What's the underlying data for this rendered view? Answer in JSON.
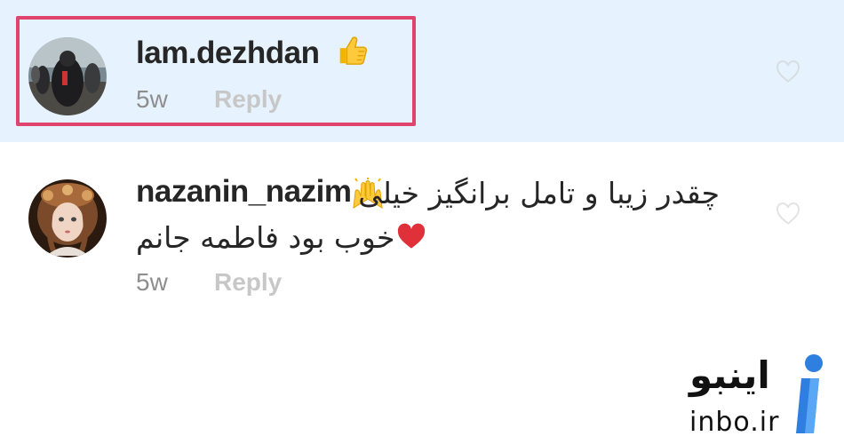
{
  "comments": [
    {
      "username": "lam.dezhdan",
      "emoji": "thumbs-up",
      "time": "5w",
      "reply_label": "Reply",
      "highlighted": true
    },
    {
      "username": "nazanin_nazim",
      "emoji": "raised-hands",
      "text_line1": "چقدر زیبا و تامل برانگیز خیلی",
      "text_line2": "خوب بود فاطمه جانم",
      "text_emoji": "red-heart",
      "time": "5w",
      "reply_label": "Reply",
      "highlighted": false
    }
  ],
  "watermark": {
    "name": "اینبو",
    "domain": "inbo.ir"
  },
  "colors": {
    "highlight_bg": "#e6f2fd",
    "highlight_border": "#e0436d",
    "reply": "#c7c7c7",
    "meta": "#8e8e8e",
    "logo_blue": "#2f7fe0"
  }
}
